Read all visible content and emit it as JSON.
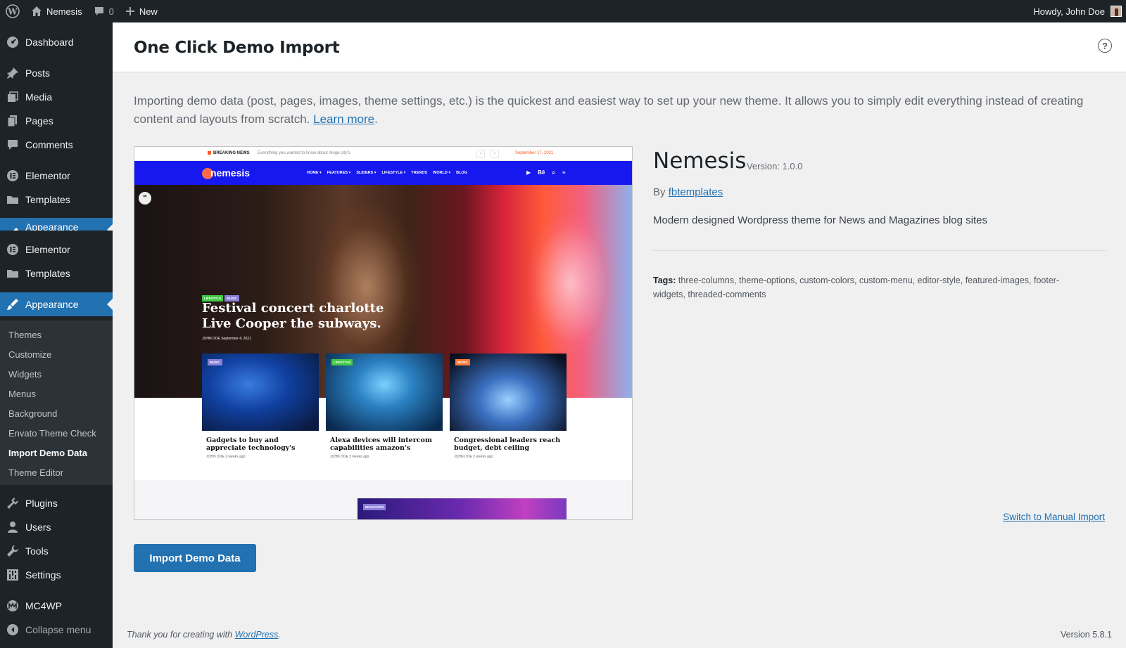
{
  "adminbar": {
    "site_name": "Nemesis",
    "comments_count": "0",
    "new_label": "New",
    "howdy": "Howdy, John Doe"
  },
  "sidebar": {
    "items": [
      {
        "label": "Dashboard",
        "icon": "dashboard-icon"
      },
      {
        "label": "Posts",
        "icon": "pin-icon"
      },
      {
        "label": "Media",
        "icon": "media-icon"
      },
      {
        "label": "Pages",
        "icon": "pages-icon"
      },
      {
        "label": "Comments",
        "icon": "comment-icon"
      },
      {
        "label": "Elementor",
        "icon": "elementor-icon"
      },
      {
        "label": "Templates",
        "icon": "folder-icon"
      },
      {
        "label": "Appearance",
        "icon": "brush-icon"
      },
      {
        "label": "Elementor",
        "icon": "elementor-icon"
      },
      {
        "label": "Templates",
        "icon": "folder-icon"
      },
      {
        "label": "Appearance",
        "icon": "brush-icon"
      }
    ],
    "submenu": [
      "Themes",
      "Customize",
      "Widgets",
      "Menus",
      "Background",
      "Envato Theme Check",
      "Import Demo Data",
      "Theme Editor"
    ],
    "bottom_items": [
      {
        "label": "Plugins",
        "icon": "plugin-icon"
      },
      {
        "label": "Users",
        "icon": "user-icon"
      },
      {
        "label": "Tools",
        "icon": "wrench-icon"
      },
      {
        "label": "Settings",
        "icon": "settings-icon"
      },
      {
        "label": "MC4WP",
        "icon": "mc4wp-icon"
      }
    ],
    "collapse_label": "Collapse menu"
  },
  "page": {
    "title": "One Click Demo Import",
    "intro": "Importing demo data (post, pages, images, theme settings, etc.) is the quickest and easiest way to set up your new theme. It allows you to simply edit everything instead of creating content and layouts from scratch.",
    "learn_more": "Learn more"
  },
  "preview": {
    "breaking": "BREAKING NEWS",
    "ticker": "Everything you wanted to know about mega city's.",
    "date": "September 17, 2021",
    "logo": "nemesis",
    "menu": [
      "HOME ▾",
      "FEATURES ▾",
      "SLIDERS ▾",
      "LIFESTYLE ▾",
      "TRENDS",
      "WORLD ▾",
      "BLOG"
    ],
    "hero_badges": [
      "LIFESTYLE",
      "MUSIC"
    ],
    "hero_title": "Festival concert charlotte Live Cooper the subways.",
    "hero_meta": "JOHN DOE   September 4, 2021",
    "cards": [
      {
        "badge": "MUSIC",
        "title": "Gadgets to buy and appreciate technology's",
        "meta": "JOHN DOE   2 weeks ago"
      },
      {
        "badge": "LIFESTYLE",
        "title": "Alexa devices will intercom capabilities amazon's",
        "meta": "JOHN DOE   2 weeks ago"
      },
      {
        "badge": "MUSIC",
        "title": "Congressional leaders reach budget, debt ceiling",
        "meta": "JOHN DOE   2 weeks ago"
      }
    ],
    "edu_badge": "EDUCATION"
  },
  "theme": {
    "name": "Nemesis",
    "version": "Version: 1.0.0",
    "by": "By",
    "author": "fbtemplates",
    "description": "Modern designed Wordpress theme for News and Magazines blog sites",
    "tags_label": "Tags:",
    "tags": "three-columns, theme-options, custom-colors, custom-menu, editor-style, featured-images, footer-widgets, threaded-comments"
  },
  "actions": {
    "manual_import": "Switch to Manual Import",
    "import_button": "Import Demo Data"
  },
  "footer": {
    "thanks_prefix": "Thank you for creating with",
    "wordpress": "WordPress",
    "version": "Version 5.8.1"
  },
  "colors": {
    "admin_dark": "#1d2327",
    "accent": "#2271b1",
    "preview_nav": "#1717f0",
    "badge_lifestyle": "#43c843",
    "badge_music": "#8a7fd8",
    "badge_music_orange": "#ff7a3a"
  }
}
